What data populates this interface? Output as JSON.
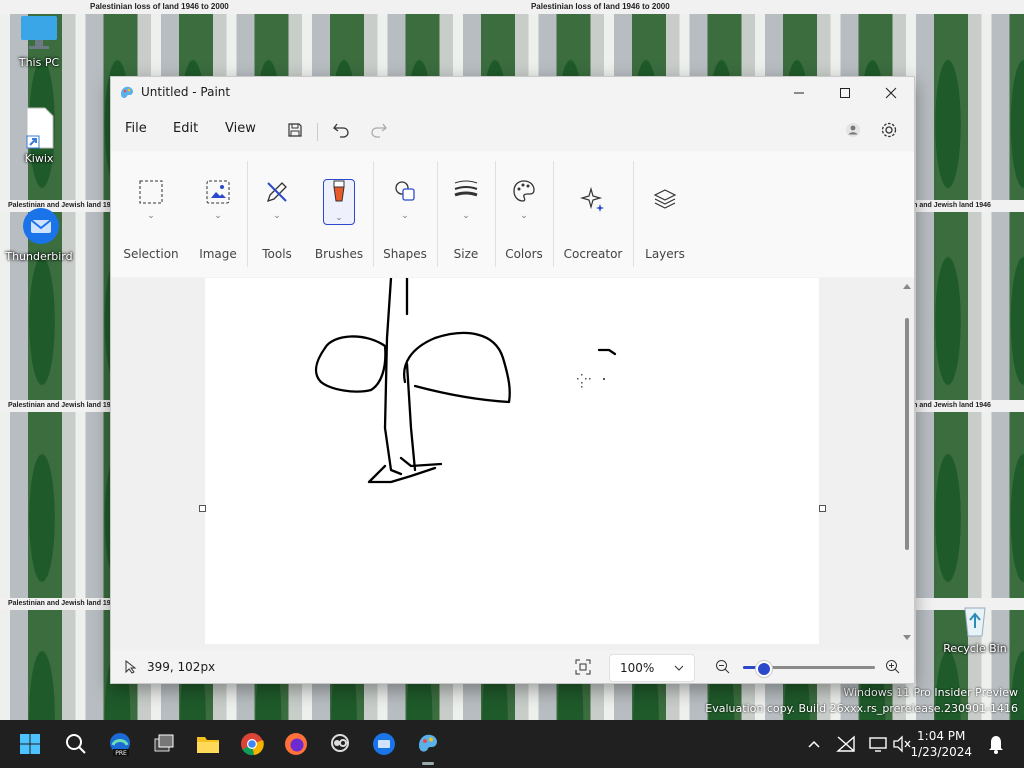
{
  "desktop": {
    "wallpaper_title": "Palestinian loss of land 1946 to 2000",
    "wallpaper_subtitle": "Palestinian and Jewish land 1946",
    "icons": [
      {
        "label": "This PC",
        "icon": "monitor-icon"
      },
      {
        "label": "Kiwix",
        "icon": "file-shortcut-icon"
      },
      {
        "label": "Thunderbird",
        "icon": "thunderbird-icon"
      },
      {
        "label": "Recycle Bin",
        "icon": "recycle-bin-icon"
      }
    ],
    "watermark_line1": "Windows 11 Pro Insider Preview",
    "watermark_line2": "Evaluation copy. Build 26xxx.rs_prerelease.230901-1416"
  },
  "window": {
    "title": "Untitled - Paint",
    "menu": [
      "File",
      "Edit",
      "View"
    ],
    "ribbon_groups": [
      {
        "label": "Selection",
        "icon": "selection-rect-icon"
      },
      {
        "label": "Image",
        "icon": "image-icon"
      },
      {
        "label": "Tools",
        "icon": "pencil-tools-icon"
      },
      {
        "label": "Brushes",
        "icon": "brush-icon"
      },
      {
        "label": "Shapes",
        "icon": "shapes-icon"
      },
      {
        "label": "Size",
        "icon": "line-size-icon"
      },
      {
        "label": "Colors",
        "icon": "palette-icon"
      },
      {
        "label": "Cocreator",
        "icon": "sparkle-icon"
      },
      {
        "label": "Layers",
        "icon": "layers-icon"
      }
    ],
    "status": {
      "cursor_position": "399, 102px",
      "zoom": "100%",
      "zoom_slider_fraction": 0.15
    }
  },
  "taskbar": {
    "time": "1:04 PM",
    "date": "1/23/2024"
  },
  "colors": {
    "accent": "#2b4acb",
    "taskbar": "#202020",
    "wallpaper_green": "#1f5a2a"
  }
}
